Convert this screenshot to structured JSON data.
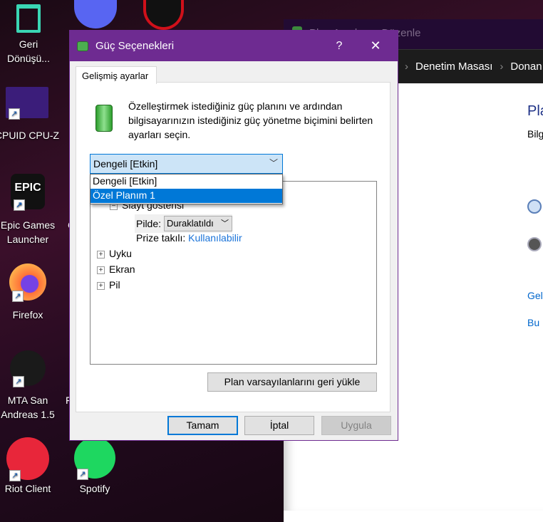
{
  "desktop": {
    "icons": [
      {
        "label": "Geri Dönüşü...",
        "icon": "recycle-bin-icon",
        "color": "#3ad6b4"
      },
      {
        "label": "CPUID CPU-Z",
        "icon": "cpu-z-icon",
        "color": "#3b1d7a"
      },
      {
        "label": "Epic Games Launcher",
        "icon": "epic-games-icon",
        "color": "#111111"
      },
      {
        "label": "Firefox",
        "icon": "firefox-icon",
        "color": "#ff7139"
      },
      {
        "label": "MTA San Andreas 1.5",
        "icon": "mta-icon",
        "color": "#222222"
      },
      {
        "label": "Riot Client",
        "icon": "riot-client-icon",
        "color": "#e8263a"
      },
      {
        "label": "Spotify",
        "icon": "spotify-icon",
        "color": "#1ed760"
      }
    ],
    "partial_icons": [
      {
        "icon": "discord-icon",
        "color": "#5865f2"
      },
      {
        "icon": "driver-booster-icon",
        "color": "#d0101a"
      }
    ],
    "partial_labels": [
      "C",
      "F"
    ]
  },
  "background_window": {
    "title": "Plan Ayarlarını Düzenle",
    "breadcrumb": [
      "Denetim Masası",
      "Donanı"
    ],
    "fragments": {
      "heading": "Pla",
      "subtext": "Bilg",
      "link1": "Gel",
      "link2": "Bu"
    }
  },
  "dialog": {
    "title": "Güç Seçenekleri",
    "help": "?",
    "close": "✕",
    "tab": "Gelişmiş ayarlar",
    "description": "Özelleştirmek istediğiniz güç planını ve ardından bilgisayarınızın istediğiniz güç yönetme biçimini belirten ayarları seçin.",
    "plan_select": {
      "value": "Dengeli [Etkin]",
      "options": [
        "Dengeli [Etkin]",
        "Özel Planım 1"
      ],
      "highlighted": "Özel Planım 1"
    },
    "tree": {
      "expanded_item": "Slayt gösterisi",
      "on_battery_label": "Pilde:",
      "on_battery_value": "Duraklatıldı",
      "plugged_in_label": "Prize takılı:",
      "plugged_in_value": "Kullanılabilir",
      "items": [
        "Uyku",
        "Ekran",
        "Pil"
      ]
    },
    "restore_button": "Plan varsayılanlarını geri yükle",
    "ok": "Tamam",
    "cancel": "İptal",
    "apply": "Uygula"
  },
  "colors": {
    "accent": "#0078d7",
    "titlebar": "#6e2b91",
    "link": "#0066cc"
  }
}
